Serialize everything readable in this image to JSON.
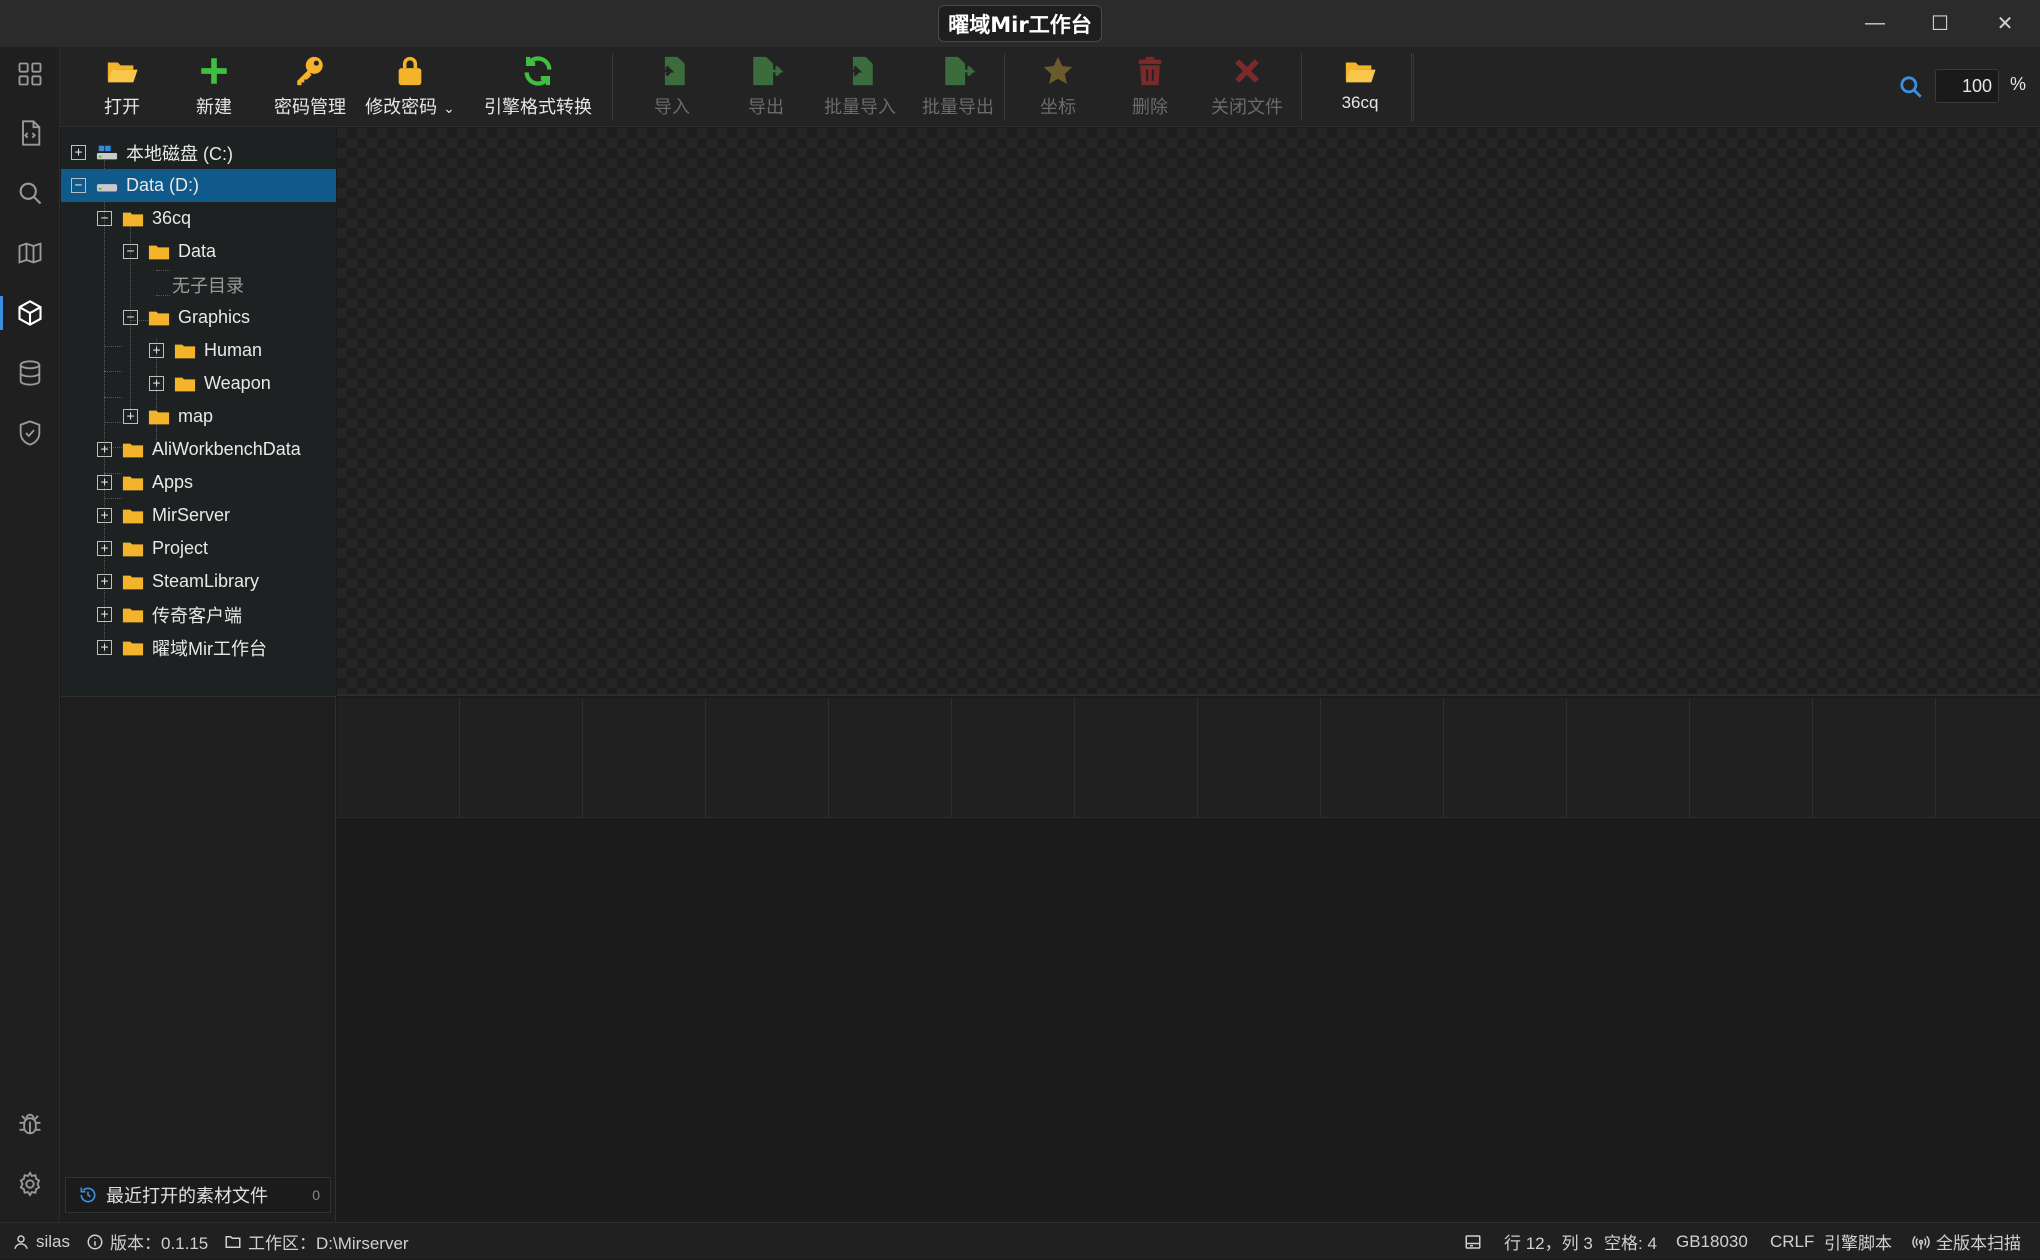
{
  "window": {
    "title": "曜域Mir工作台",
    "minimize": "—",
    "maximize": "☐",
    "close": "✕"
  },
  "toolbar": {
    "open": "打开",
    "new": "新建",
    "password_manage": "密码管理",
    "change_password": "修改密码",
    "engine_convert": "引擎格式转换",
    "import": "导入",
    "export": "导出",
    "batch_import": "批量导入",
    "batch_export": "批量导出",
    "coordinates": "坐标",
    "delete": "删除",
    "close_file": "关闭文件",
    "folder_36cq": "36cq",
    "zoom_value": "100",
    "zoom_unit": "%"
  },
  "tree": {
    "drive_c": "本地磁盘 (C:)",
    "drive_d": "Data (D:)",
    "n_36cq": "36cq",
    "n_data": "Data",
    "n_empty": "无子目录",
    "n_graphics": "Graphics",
    "n_human": "Human",
    "n_weapon": "Weapon",
    "n_map": "map",
    "n_aliwork": "AliWorkbenchData",
    "n_apps": "Apps",
    "n_mirserver": "MirServer",
    "n_project": "Project",
    "n_steam": "SteamLibrary",
    "n_legend": "传奇客户端",
    "n_yaoyu": "曜域Mir工作台",
    "toggle_plus": "+",
    "toggle_minus": "−"
  },
  "recent": {
    "label": "最近打开的素材文件",
    "count": "0"
  },
  "statusbar": {
    "user": "silas",
    "version": "版本：0.1.15",
    "workspace": "工作区：D:\\Mirserver",
    "position": "行 12，列 3",
    "spaces": "空格: 4",
    "encoding": "GB18030",
    "eol": "CRLF",
    "language": "引擎脚本",
    "scan": "全版本扫描"
  },
  "colors": {
    "accent": "#0f5a8a",
    "folder": "#f3b32a",
    "icon_open": "#f3b32a",
    "icon_new": "#3fbf3f",
    "icon_convert": "#3fbf3f",
    "icon_disabled_green": "#3c6b3c",
    "icon_disabled_star": "#6b5a2a",
    "icon_disabled_red": "#7a2a2a"
  }
}
